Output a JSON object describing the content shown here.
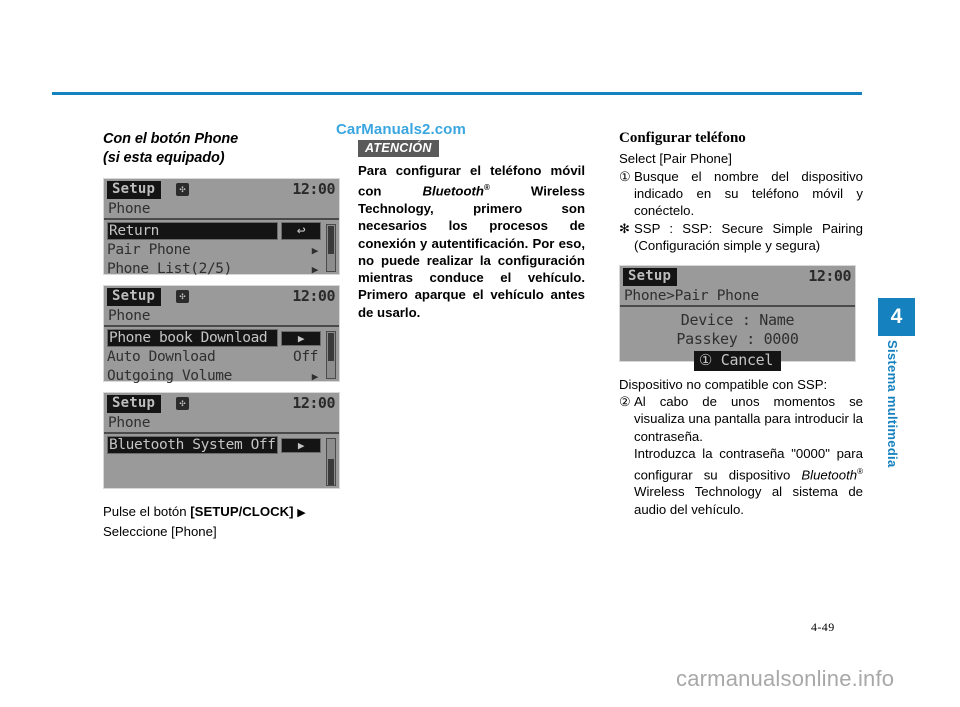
{
  "watermarks": {
    "top": "CarManuals2.com",
    "bottom": "carmanualsonline.info"
  },
  "chapter": {
    "number": "4",
    "label": "Sistema multimedia"
  },
  "page_number": "4-49",
  "left_column": {
    "heading_line1": "Con el botón Phone",
    "heading_line2": "(si esta equipado)",
    "screens": [
      {
        "title": "Setup",
        "bt_icon": "bluetooth-icon",
        "clock": "12:00",
        "path": "Phone",
        "rows": [
          {
            "label": "Return",
            "value": "↩",
            "selected": true
          },
          {
            "label": "Pair Phone",
            "value": "▶",
            "selected": false
          },
          {
            "label": "Phone List(2/5)",
            "value": "▶",
            "selected": false
          }
        ],
        "scroll_position": "top"
      },
      {
        "title": "Setup",
        "bt_icon": "bluetooth-icon",
        "clock": "12:00",
        "path": "Phone",
        "rows": [
          {
            "label": "Phone book Download",
            "value": "▶",
            "selected": true
          },
          {
            "label": "Auto Download",
            "value": "Off",
            "selected": false
          },
          {
            "label": "Outgoing Volume",
            "value": "▶",
            "selected": false
          }
        ],
        "scroll_position": "middle"
      },
      {
        "title": "Setup",
        "bt_icon": "bluetooth-icon",
        "clock": "12:00",
        "path": "Phone",
        "rows": [
          {
            "label": "Bluetooth System Off",
            "value": "▶",
            "selected": true
          }
        ],
        "scroll_position": "bottom"
      }
    ],
    "instruction_line1_pre": "Pulse  el  botón ",
    "instruction_button": "[SETUP/CLOCK]",
    "instruction_arrow": "▶",
    "instruction_line2": "Seleccione [Phone]"
  },
  "mid_column": {
    "caution_label": "ATENCIÓN",
    "caution_text_1": "Para configurar el teléfono móvil con ",
    "caution_bluetooth": "Bluetooth",
    "caution_reg": "®",
    "caution_text_2": " Wireless Technology, primero son necesarios los procesos de conexión y autentificación. Por eso, no puede realizar la configuración mientras conduce el vehículo. Primero aparque el vehículo antes de usarlo."
  },
  "right_column": {
    "heading": "Configurar teléfono",
    "select_line": "Select [Pair Phone]",
    "item1_marker": "①",
    "item1_text": "Busque el nombre del dispositivo indicado en su teléfono móvil y conéctelo.",
    "item2_marker": "✻",
    "item2_text": "SSP : SSP: Secure Simple Pairing (Configuración simple y segura)",
    "screen": {
      "title": "Setup",
      "clock": "12:00",
      "path": "Phone>Pair Phone",
      "device_line": "Device : Name",
      "passkey_line": "Passkey : 0000",
      "cancel_marker": "①",
      "cancel_label": "Cancel"
    },
    "ssp_note": "Dispositivo no compatible con SSP:",
    "item3_marker": "②",
    "item3_text": "Al cabo de unos momentos se visualiza una pantalla para introducir la contraseña.",
    "item4_text_1": "Introduzca la contraseña \"0000\" para configurar su dispositivo ",
    "item4_bluetooth": "Bluetooth",
    "item4_reg": "®",
    "item4_text_2": " Wireless Technology al sistema de audio del vehículo."
  },
  "colors": {
    "accent": "#1681bf",
    "lcd_bg": "#9a9a9a",
    "lcd_dark": "#141414"
  }
}
